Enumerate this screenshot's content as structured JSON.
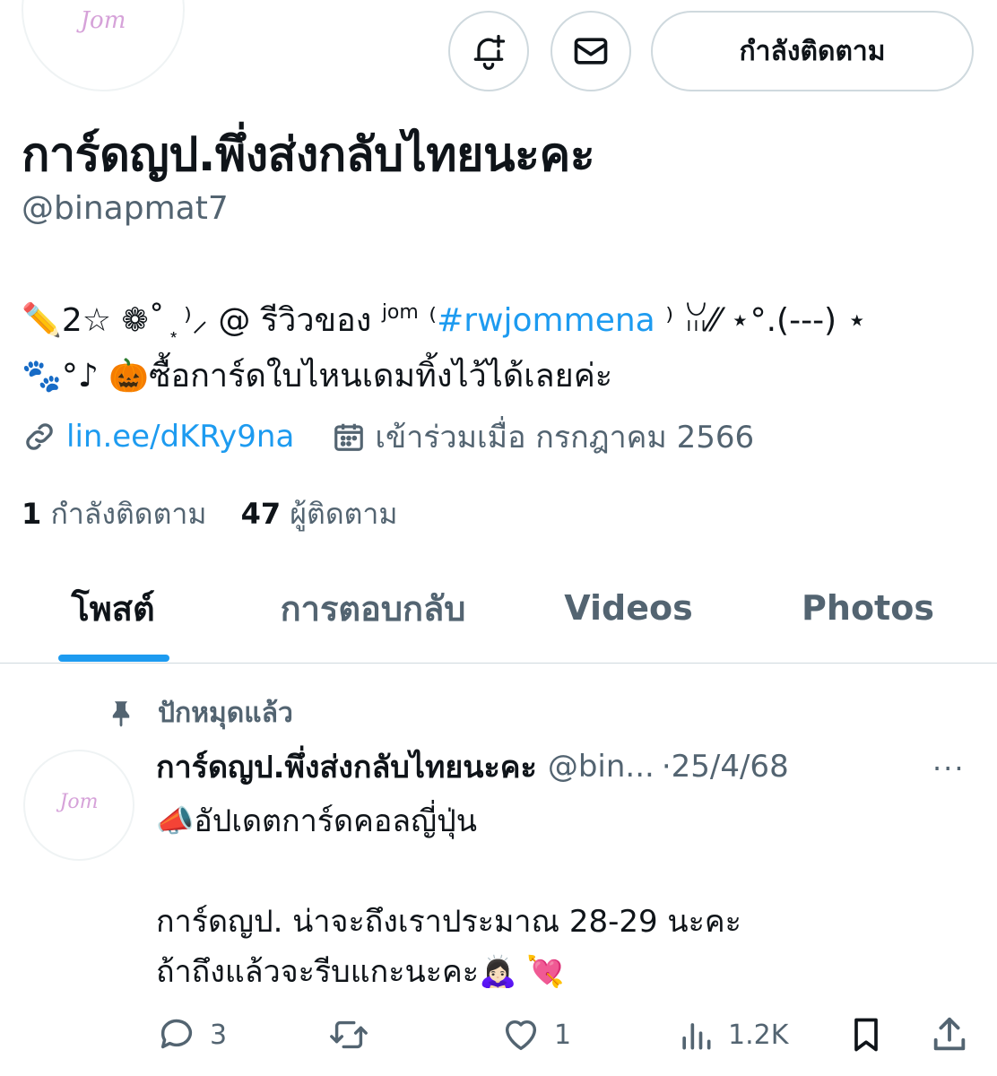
{
  "profile": {
    "avatar_text": "Jom",
    "name": "การ์ดญป.พึ่งส่งกลับไทยนะคะ",
    "handle": "@binapmat7",
    "follow_button": "กำลังติดตาม",
    "bio_line1_prefix": "✏️2☆ ❁˚ ͙ ⁾⸝ @ รีวิวของ",
    "bio_line1_sup": "jom",
    "bio_line1_open": " ⁽",
    "bio_hashtag": "#rwjommena",
    "bio_line1_suffix": "⁾ ꈍ⁄⁄ ⋆°.(---) ⋆",
    "bio_line2": "🐾°♪ 🎃ซื้อการ์ดใบไหนเดมทิ้งไว้ได้เลยค่ะ",
    "link": "lin.ee/dKRy9na",
    "joined": "เข้าร่วมเมื่อ กรกฎาคม 2566",
    "following_count": "1",
    "following_label": "กำลังติดตาม",
    "followers_count": "47",
    "followers_label": "ผู้ติดตาม"
  },
  "tabs": [
    {
      "label": "โพสต์",
      "active": true
    },
    {
      "label": "การตอบกลับ",
      "active": false
    },
    {
      "label": "Videos",
      "active": false
    },
    {
      "label": "Photos",
      "active": false
    }
  ],
  "post": {
    "pinned_label": "ปักหมุดแล้ว",
    "author": "การ์ดญป.พึ่งส่งกลับไทยนะคะ",
    "handle": "@bin...",
    "separator": "·",
    "date": "25/4/68",
    "more": "···",
    "line1": "📣อัปเดตการ์ดคอลญี่ปุ่น",
    "line2": "การ์ดญป. น่าจะถึงเราประมาณ 28-29 นะคะ",
    "line3": "ถ้าถึงแล้วจะรีบแกะนะคะ🙇🏻‍♀️ 💘",
    "replies": "3",
    "likes": "1",
    "views": "1.2K"
  },
  "colors": {
    "accent": "#1d9bf0",
    "text_secondary": "#536471",
    "text_primary": "#0f1419",
    "border": "#cfd9de"
  }
}
